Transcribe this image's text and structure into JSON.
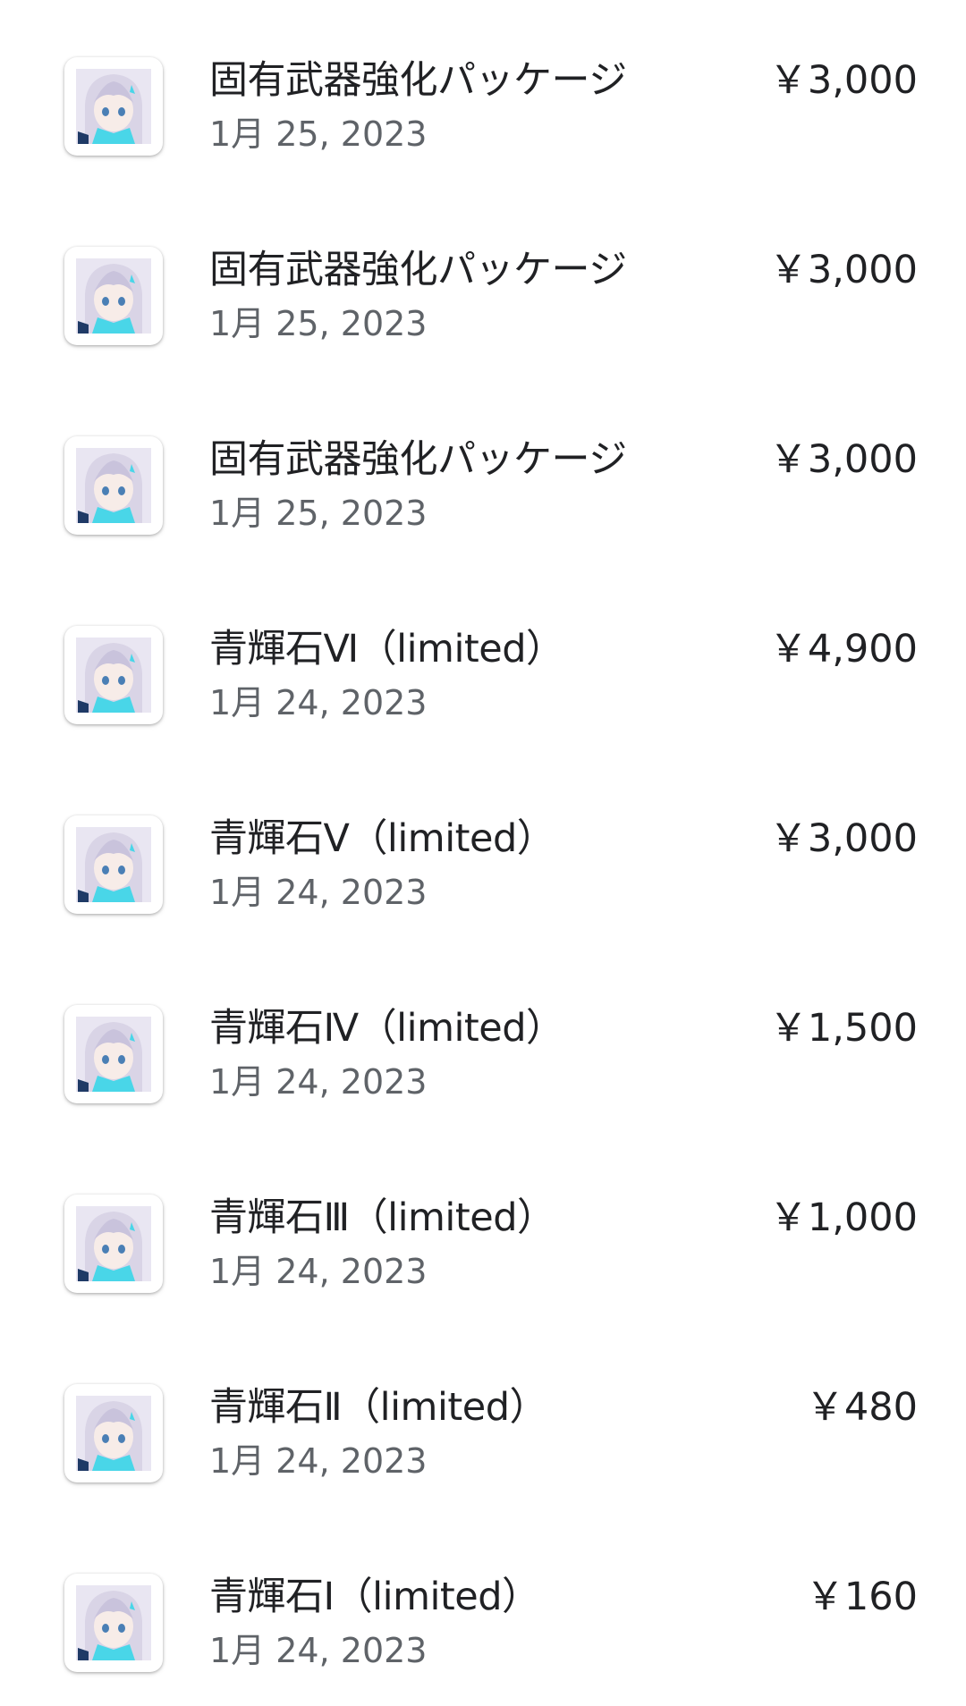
{
  "purchases": [
    {
      "title": "固有武器強化パッケージ",
      "date": "1月 25, 2023",
      "price": "￥3,000",
      "icon": "game-character-icon"
    },
    {
      "title": "固有武器強化パッケージ",
      "date": "1月 25, 2023",
      "price": "￥3,000",
      "icon": "game-character-icon"
    },
    {
      "title": "固有武器強化パッケージ",
      "date": "1月 25, 2023",
      "price": "￥3,000",
      "icon": "game-character-icon"
    },
    {
      "title": "青輝石Ⅵ（limited）",
      "date": "1月 24, 2023",
      "price": "￥4,900",
      "icon": "game-character-icon"
    },
    {
      "title": "青輝石Ⅴ（limited）",
      "date": "1月 24, 2023",
      "price": "￥3,000",
      "icon": "game-character-icon"
    },
    {
      "title": "青輝石Ⅳ（limited）",
      "date": "1月 24, 2023",
      "price": "￥1,500",
      "icon": "game-character-icon"
    },
    {
      "title": "青輝石Ⅲ（limited）",
      "date": "1月 24, 2023",
      "price": "￥1,000",
      "icon": "game-character-icon"
    },
    {
      "title": "青輝石Ⅱ（limited）",
      "date": "1月 24, 2023",
      "price": "￥480",
      "icon": "game-character-icon"
    },
    {
      "title": "青輝石Ⅰ（limited）",
      "date": "1月 24, 2023",
      "price": "￥160",
      "icon": "game-character-icon"
    }
  ],
  "colors": {
    "title": "#202124",
    "date": "#5f6368",
    "background": "#ffffff",
    "icon_hair": "#d9d4e6",
    "icon_accent": "#49d6e8"
  }
}
